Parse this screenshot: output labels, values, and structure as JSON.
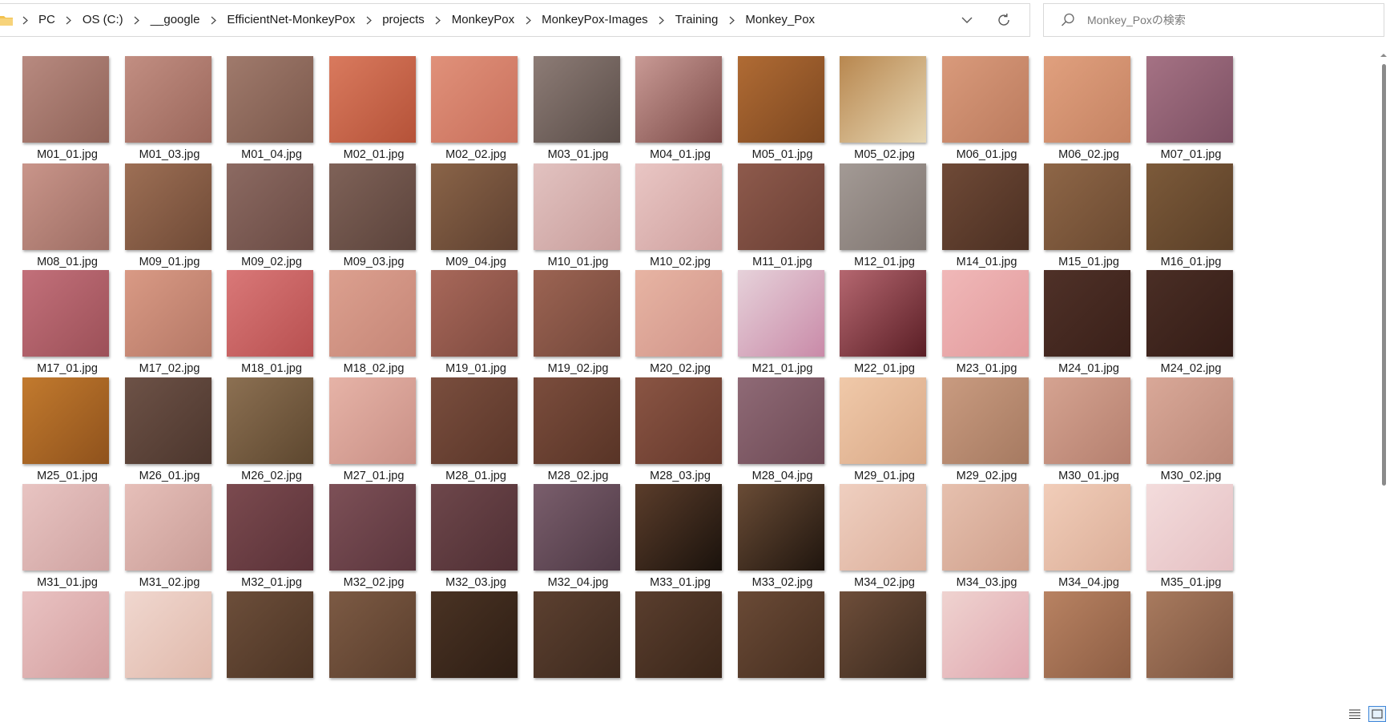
{
  "breadcrumb": [
    "PC",
    "OS (C:)",
    "__google",
    "EfficientNet-MonkeyPox",
    "projects",
    "MonkeyPox",
    "MonkeyPox-Images",
    "Training",
    "Monkey_Pox"
  ],
  "search": {
    "placeholder": "Monkey_Poxの検索"
  },
  "icons": {
    "folder": "folder-icon",
    "crumb_separator": "chevron-right-icon",
    "address_dropdown": "chevron-down-icon",
    "refresh": "refresh-icon",
    "search": "search-icon",
    "details_view": "details-view-icon",
    "large_icons_view": "large-icons-view-icon"
  },
  "colors": {
    "folder": "#f2c14e",
    "selection_border": "#3f86d8"
  },
  "files": [
    {
      "name": "M01_01.jpg",
      "tone": [
        "#b88a80",
        "#8f6358"
      ]
    },
    {
      "name": "M01_03.jpg",
      "tone": [
        "#c28e82",
        "#9a675b"
      ]
    },
    {
      "name": "M01_04.jpg",
      "tone": [
        "#a07a6c",
        "#7a584b"
      ]
    },
    {
      "name": "M02_01.jpg",
      "tone": [
        "#d97a5e",
        "#b55238"
      ]
    },
    {
      "name": "M02_02.jpg",
      "tone": [
        "#e0917a",
        "#c9705c"
      ]
    },
    {
      "name": "M03_01.jpg",
      "tone": [
        "#8d7c76",
        "#5a4d48"
      ]
    },
    {
      "name": "M04_01.jpg",
      "tone": [
        "#c99a95",
        "#7b4a47"
      ]
    },
    {
      "name": "M05_01.jpg",
      "tone": [
        "#b06b34",
        "#7c4720"
      ]
    },
    {
      "name": "M05_02.jpg",
      "tone": [
        "#b8874f",
        "#e6d6b2"
      ]
    },
    {
      "name": "M06_01.jpg",
      "tone": [
        "#d99a7b",
        "#bb7b5e"
      ]
    },
    {
      "name": "M06_02.jpg",
      "tone": [
        "#e0a07e",
        "#c58363"
      ]
    },
    {
      "name": "M07_01.jpg",
      "tone": [
        "#a57284",
        "#7c5063"
      ]
    },
    {
      "name": "M08_01.jpg",
      "tone": [
        "#c9958a",
        "#9d6d63"
      ]
    },
    {
      "name": "M09_01.jpg",
      "tone": [
        "#9d6f55",
        "#6f4a36"
      ]
    },
    {
      "name": "M09_02.jpg",
      "tone": [
        "#8c6a62",
        "#6a4b44"
      ]
    },
    {
      "name": "M09_03.jpg",
      "tone": [
        "#7f6258",
        "#5b433b"
      ]
    },
    {
      "name": "M09_04.jpg",
      "tone": [
        "#8a6448",
        "#5e4030"
      ]
    },
    {
      "name": "M10_01.jpg",
      "tone": [
        "#e2c2c0",
        "#c89e9c"
      ]
    },
    {
      "name": "M10_02.jpg",
      "tone": [
        "#e9c6c4",
        "#cfa19f"
      ]
    },
    {
      "name": "M11_01.jpg",
      "tone": [
        "#8e5a4c",
        "#6a3f34"
      ]
    },
    {
      "name": "M12_01.jpg",
      "tone": [
        "#a39a95",
        "#7f7570"
      ]
    },
    {
      "name": "M14_01.jpg",
      "tone": [
        "#6f4a37",
        "#4b2f22"
      ]
    },
    {
      "name": "M15_01.jpg",
      "tone": [
        "#8e6647",
        "#6b4a31"
      ]
    },
    {
      "name": "M16_01.jpg",
      "tone": [
        "#7c5a3a",
        "#5a3f27"
      ]
    },
    {
      "name": "M17_01.jpg",
      "tone": [
        "#c2707a",
        "#9c5058"
      ]
    },
    {
      "name": "M17_02.jpg",
      "tone": [
        "#d99a85",
        "#b57866"
      ]
    },
    {
      "name": "M18_01.jpg",
      "tone": [
        "#d97878",
        "#b85050"
      ]
    },
    {
      "name": "M18_02.jpg",
      "tone": [
        "#dca08f",
        "#c58677"
      ]
    },
    {
      "name": "M19_01.jpg",
      "tone": [
        "#a8685a",
        "#7e4a3f"
      ]
    },
    {
      "name": "M19_02.jpg",
      "tone": [
        "#9c6453",
        "#73473a"
      ]
    },
    {
      "name": "M20_02.jpg",
      "tone": [
        "#e7b4a3",
        "#d1958a"
      ]
    },
    {
      "name": "M21_01.jpg",
      "tone": [
        "#e6d2da",
        "#c98aa8"
      ]
    },
    {
      "name": "M22_01.jpg",
      "tone": [
        "#b56770",
        "#5a1e25"
      ]
    },
    {
      "name": "M23_01.jpg",
      "tone": [
        "#f0b8b8",
        "#e29a9c"
      ]
    },
    {
      "name": "M24_01.jpg",
      "tone": [
        "#4f3128",
        "#3a2019"
      ]
    },
    {
      "name": "M24_02.jpg",
      "tone": [
        "#4a2e25",
        "#341c16"
      ]
    },
    {
      "name": "M25_01.jpg",
      "tone": [
        "#c27a2e",
        "#8f521c"
      ]
    },
    {
      "name": "M26_01.jpg",
      "tone": [
        "#6d5247",
        "#4c362d"
      ]
    },
    {
      "name": "M26_02.jpg",
      "tone": [
        "#8c7052",
        "#5d472f"
      ]
    },
    {
      "name": "M27_01.jpg",
      "tone": [
        "#e6b3a7",
        "#c99086"
      ]
    },
    {
      "name": "M28_01.jpg",
      "tone": [
        "#7a4e3e",
        "#5a3629"
      ]
    },
    {
      "name": "M28_02.jpg",
      "tone": [
        "#7b4d3d",
        "#583426"
      ]
    },
    {
      "name": "M28_03.jpg",
      "tone": [
        "#8a5544",
        "#66392c"
      ]
    },
    {
      "name": "M28_04.jpg",
      "tone": [
        "#8f6a76",
        "#6e4a55"
      ]
    },
    {
      "name": "M29_01.jpg",
      "tone": [
        "#f0c9a9",
        "#d9a988"
      ]
    },
    {
      "name": "M29_02.jpg",
      "tone": [
        "#c99b80",
        "#a67a61"
      ]
    },
    {
      "name": "M30_01.jpg",
      "tone": [
        "#d5a391",
        "#b5806f"
      ]
    },
    {
      "name": "M30_02.jpg",
      "tone": [
        "#d9a898",
        "#bb8979"
      ]
    },
    {
      "name": "M31_01.jpg",
      "tone": [
        "#e8c4c2",
        "#cfa3a1"
      ]
    },
    {
      "name": "M31_02.jpg",
      "tone": [
        "#e6bfb9",
        "#c99d97"
      ]
    },
    {
      "name": "M32_01.jpg",
      "tone": [
        "#7b4a4f",
        "#5a3238"
      ]
    },
    {
      "name": "M32_02.jpg",
      "tone": [
        "#7d5057",
        "#5b363d"
      ]
    },
    {
      "name": "M32_03.jpg",
      "tone": [
        "#6e474b",
        "#4f2f34"
      ]
    },
    {
      "name": "M32_04.jpg",
      "tone": [
        "#7a5e6c",
        "#4e3945"
      ]
    },
    {
      "name": "M33_01.jpg",
      "tone": [
        "#5b3d2b",
        "#1a120c"
      ]
    },
    {
      "name": "M33_02.jpg",
      "tone": [
        "#6a4c36",
        "#1f150e"
      ]
    },
    {
      "name": "M34_02.jpg",
      "tone": [
        "#efcfc0",
        "#dcb09c"
      ]
    },
    {
      "name": "M34_03.jpg",
      "tone": [
        "#e6c0ae",
        "#cfa08c"
      ]
    },
    {
      "name": "M34_04.jpg",
      "tone": [
        "#f1cdb9",
        "#dbae98"
      ]
    },
    {
      "name": "M35_01.jpg",
      "tone": [
        "#f3dcdc",
        "#e5c0c3"
      ]
    },
    {
      "name": "",
      "tone": [
        "#e9c2c2",
        "#d4a0a0"
      ]
    },
    {
      "name": "",
      "tone": [
        "#f0d7cf",
        "#e0b9ab"
      ]
    },
    {
      "name": "",
      "tone": [
        "#6c4e3a",
        "#4c3424"
      ]
    },
    {
      "name": "",
      "tone": [
        "#7c5a44",
        "#5a3e2c"
      ]
    },
    {
      "name": "",
      "tone": [
        "#4a3324",
        "#2e1e14"
      ]
    },
    {
      "name": "",
      "tone": [
        "#5c4030",
        "#3e2a1e"
      ]
    },
    {
      "name": "",
      "tone": [
        "#5a3e2e",
        "#3a2619"
      ]
    },
    {
      "name": "",
      "tone": [
        "#6a4a36",
        "#472f20"
      ]
    },
    {
      "name": "",
      "tone": [
        "#6e4e3a",
        "#3c2a1e"
      ]
    },
    {
      "name": "",
      "tone": [
        "#efd3d0",
        "#e0a8b0"
      ]
    },
    {
      "name": "",
      "tone": [
        "#b88262",
        "#8d5e44"
      ]
    },
    {
      "name": "",
      "tone": [
        "#a87a5e",
        "#7c5540"
      ]
    }
  ]
}
